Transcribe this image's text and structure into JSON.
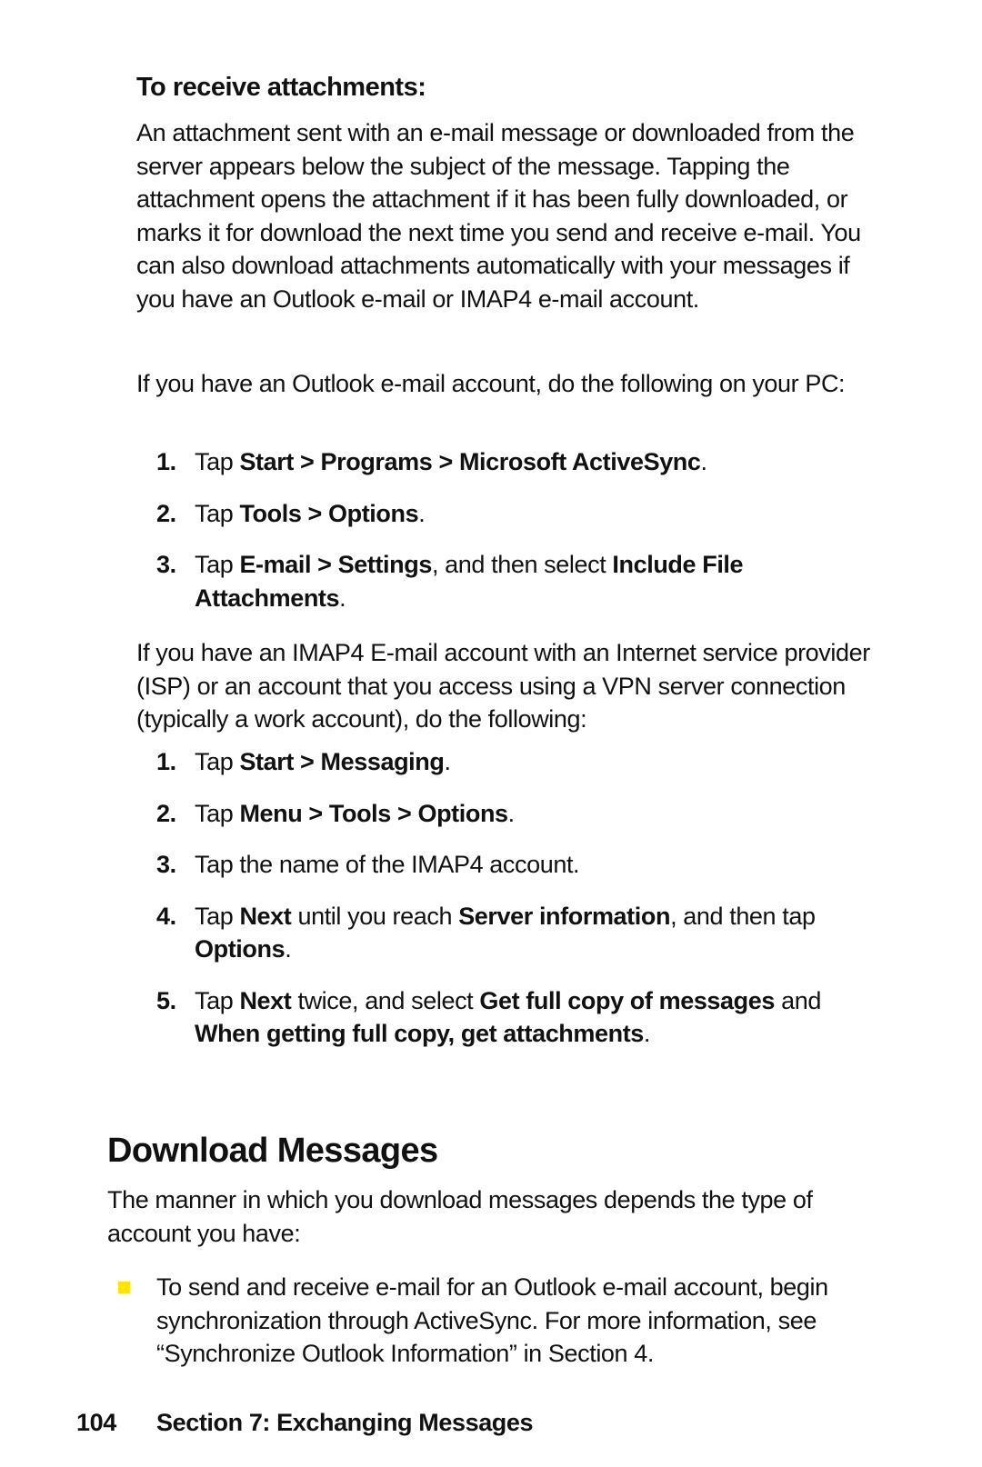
{
  "subsection": {
    "heading": "To receive attachments:",
    "intro": "An attachment sent with an e-mail message or downloaded from the server appears below the subject of the message. Tapping the attachment opens the attachment if it has been fully downloaded, or marks it for download the next time you send and receive e-mail. You can also download attachments automatically with your messages if you have an Outlook e-mail or IMAP4 e-mail account.",
    "outlook_intro": "If you have an Outlook e-mail account, do the following on your PC:",
    "outlook_steps": [
      {
        "num": "1.",
        "parts": [
          [
            "Tap ",
            false
          ],
          [
            "Start > Programs > Microsoft ActiveSync",
            true
          ],
          [
            ".",
            false
          ]
        ]
      },
      {
        "num": "2.",
        "parts": [
          [
            "Tap ",
            false
          ],
          [
            "Tools > Options",
            true
          ],
          [
            ".",
            false
          ]
        ]
      },
      {
        "num": "3.",
        "parts": [
          [
            "Tap ",
            false
          ],
          [
            "E-mail > Settings",
            true
          ],
          [
            ", and then select ",
            false
          ],
          [
            "Include File Attachments",
            true
          ],
          [
            ".",
            false
          ]
        ]
      }
    ],
    "imap_intro": "If you have an IMAP4 E-mail account with an Internet service provider (ISP) or an account that you access using a VPN server connection (typically a work account), do the following:",
    "imap_steps": [
      {
        "num": "1.",
        "parts": [
          [
            "Tap ",
            false
          ],
          [
            "Start > Messaging",
            true
          ],
          [
            ".",
            false
          ]
        ]
      },
      {
        "num": "2.",
        "parts": [
          [
            "Tap ",
            false
          ],
          [
            "Menu > Tools > Options",
            true
          ],
          [
            ".",
            false
          ]
        ]
      },
      {
        "num": "3.",
        "parts": [
          [
            "Tap the name of the IMAP4 account.",
            false
          ]
        ]
      },
      {
        "num": "4.",
        "parts": [
          [
            "Tap ",
            false
          ],
          [
            "Next",
            true
          ],
          [
            " until you reach ",
            false
          ],
          [
            "Server information",
            true
          ],
          [
            ", and then tap ",
            false
          ],
          [
            "Options",
            true
          ],
          [
            ".",
            false
          ]
        ]
      },
      {
        "num": "5.",
        "parts": [
          [
            "Tap ",
            false
          ],
          [
            "Next",
            true
          ],
          [
            " twice, and select ",
            false
          ],
          [
            "Get full copy of messages",
            true
          ],
          [
            " and ",
            false
          ],
          [
            "When getting full copy, get attachments",
            true
          ],
          [
            ".",
            false
          ]
        ]
      }
    ]
  },
  "section": {
    "title": "Download Messages",
    "intro": "The manner in which you download messages depends the type of account you have:",
    "bullets": [
      "To send and receive e-mail for an Outlook e-mail account, begin synchronization through ActiveSync. For more information, see “Synchronize Outlook Information” in Section 4."
    ],
    "bullet_color": "#FFE500"
  },
  "footer": {
    "page_number": "104",
    "section_label": "Section 7: Exchanging Messages"
  }
}
